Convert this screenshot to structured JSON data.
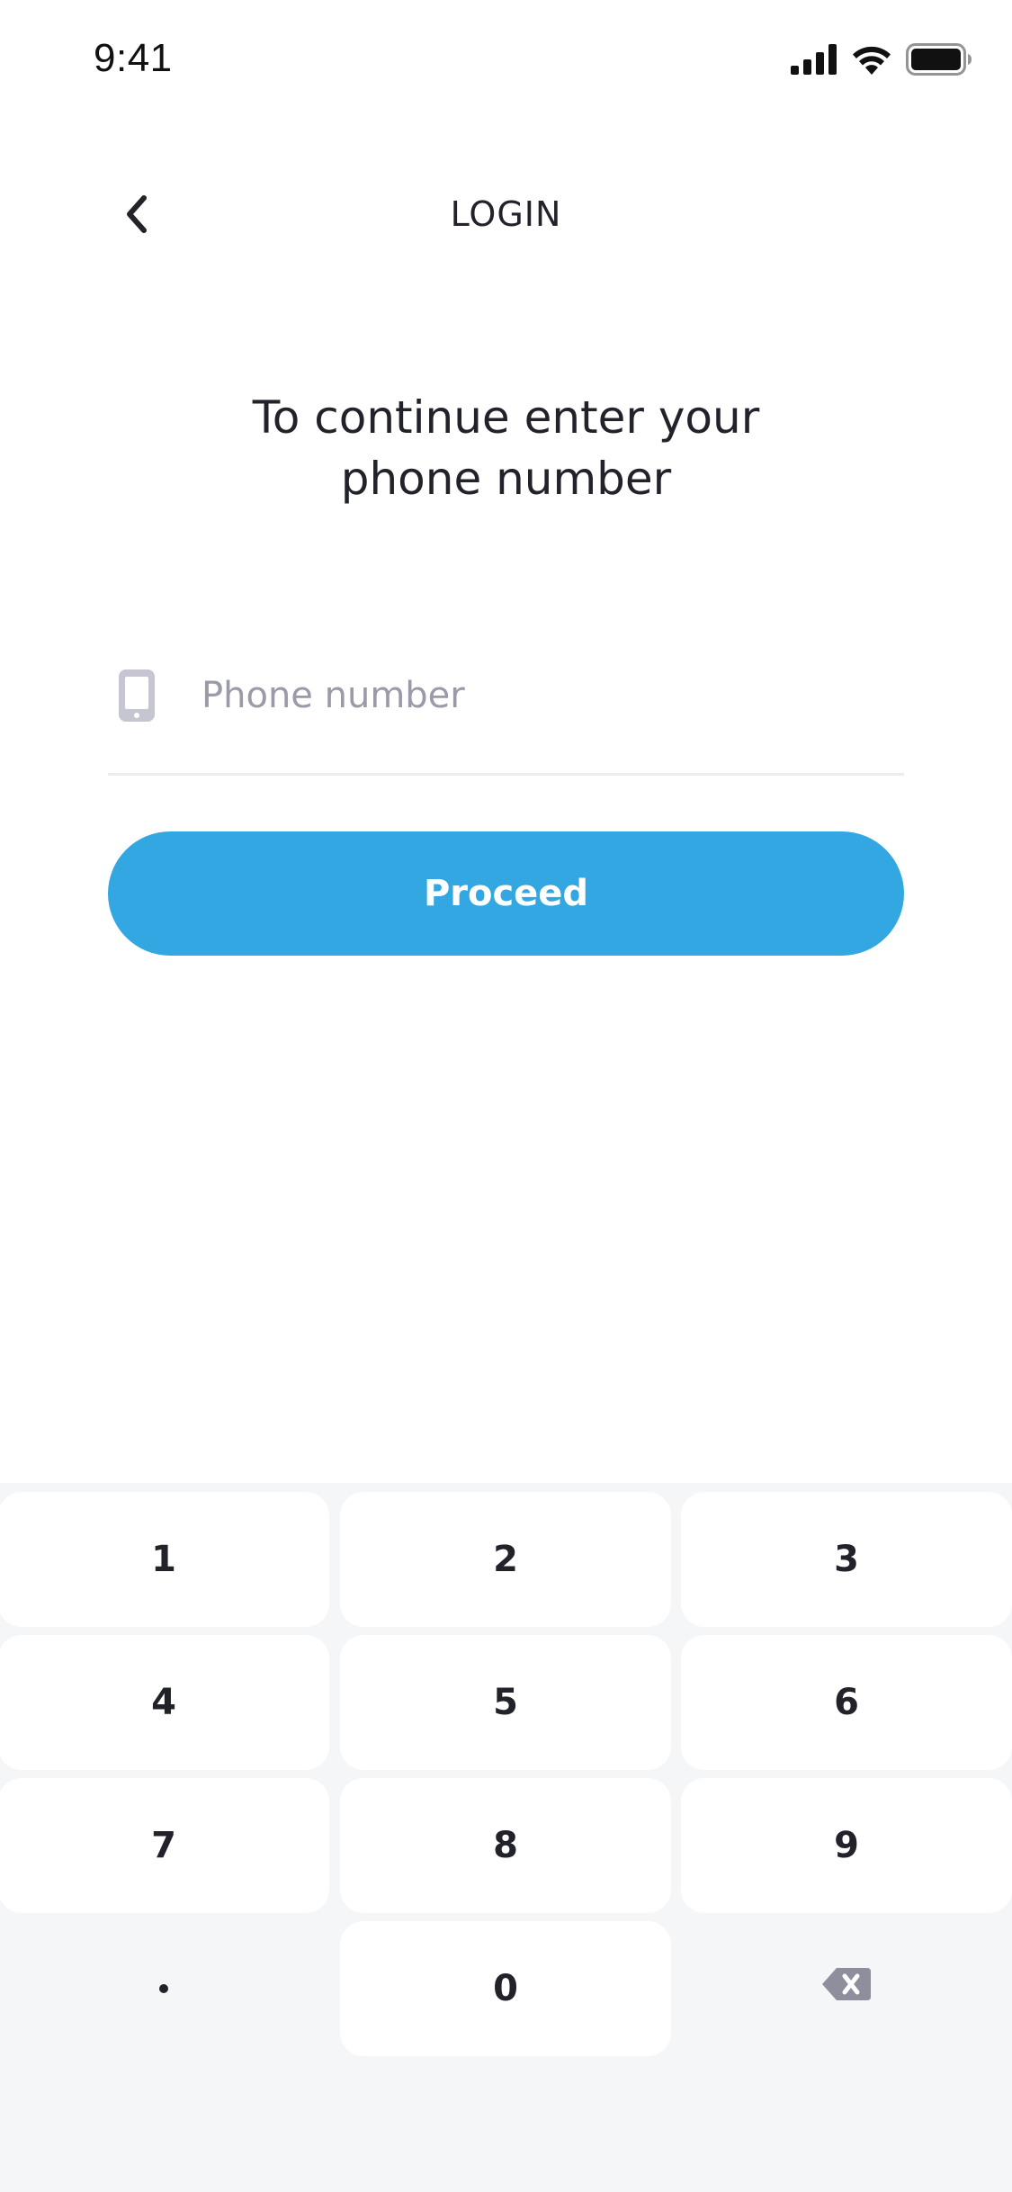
{
  "status_bar": {
    "time": "9:41",
    "icons": [
      "cellular-signal-icon",
      "wifi-icon",
      "battery-icon"
    ]
  },
  "header": {
    "title": "LOGIN",
    "back_icon": "chevron-left-icon"
  },
  "prompt": {
    "line1": "To continue enter your",
    "line2": "phone number"
  },
  "phone_field": {
    "icon": "mobile-phone-icon",
    "placeholder": "Phone number",
    "value": ""
  },
  "proceed_button": {
    "label": "Proceed"
  },
  "keypad": {
    "keys": [
      "1",
      "2",
      "3",
      "4",
      "5",
      "6",
      "7",
      "8",
      "9",
      "0"
    ],
    "dot_icon": "dot-icon",
    "backspace_icon": "backspace-icon"
  },
  "colors": {
    "accent": "#33a7e2",
    "text_primary": "#22232a",
    "placeholder": "#9a9aa8",
    "keypad_background": "#f5f6f8",
    "key_background": "#ffffff",
    "icon_muted": "#c5c6d2",
    "backspace": "#8e8f9c"
  }
}
